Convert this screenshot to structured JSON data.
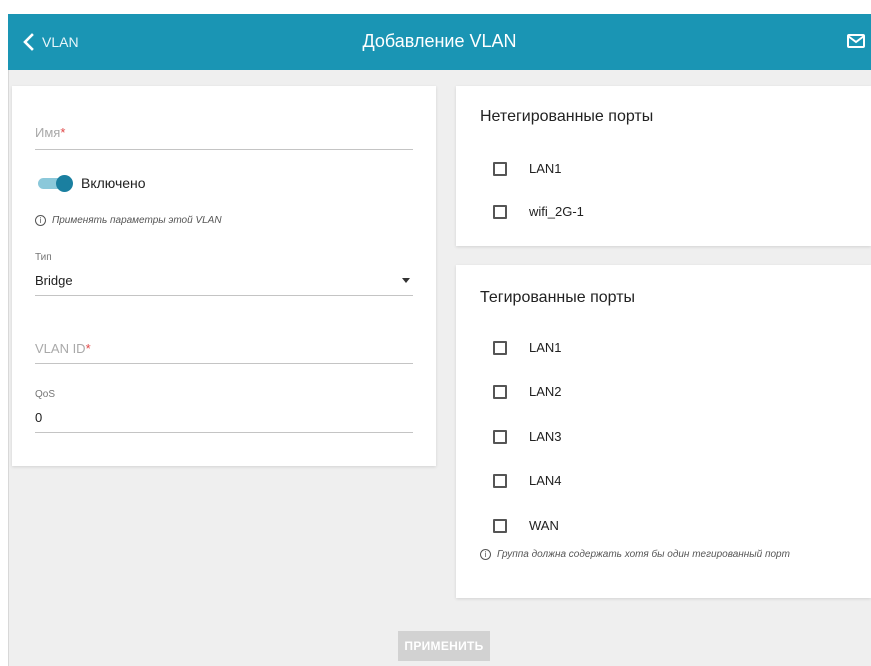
{
  "header": {
    "back_label": "VLAN",
    "title": "Добавление VLAN",
    "back_icon": "chevron-left-icon",
    "mail_icon": "mail-icon",
    "color": "#1a95b4"
  },
  "form": {
    "name": {
      "placeholder": "Имя",
      "required_mark": "*",
      "value": ""
    },
    "enabled_toggle": {
      "label": "Включено",
      "on": true
    },
    "enabled_hint": "Применять параметры этой VLAN",
    "type": {
      "label": "Тип",
      "value": "Bridge"
    },
    "vlan_id": {
      "placeholder": "VLAN ID",
      "required_mark": "*",
      "value": ""
    },
    "qos": {
      "label": "QoS",
      "value": "0"
    }
  },
  "untagged": {
    "title": "Нетегированные порты",
    "ports": [
      {
        "label": "LAN1",
        "checked": false
      },
      {
        "label": "wifi_2G-1",
        "checked": false
      }
    ]
  },
  "tagged": {
    "title": "Тегированные порты",
    "ports": [
      {
        "label": "LAN1",
        "checked": false
      },
      {
        "label": "LAN2",
        "checked": false
      },
      {
        "label": "LAN3",
        "checked": false
      },
      {
        "label": "LAN4",
        "checked": false
      },
      {
        "label": "WAN",
        "checked": false
      }
    ],
    "hint": "Группа должна содержать хотя бы один тегированный порт"
  },
  "apply_label": "ПРИМЕНИТЬ"
}
